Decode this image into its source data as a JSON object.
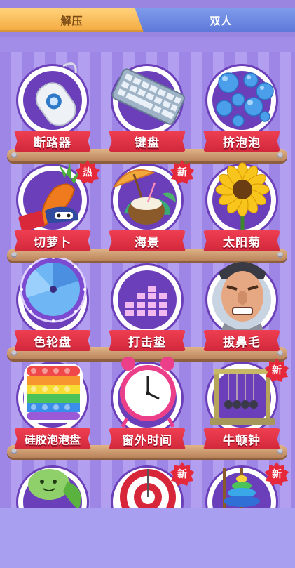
{
  "tabs": {
    "active_label": "解压",
    "inactive_label": "双人"
  },
  "items": [
    {
      "label": "断路器",
      "badge": ""
    },
    {
      "label": "键盘",
      "badge": ""
    },
    {
      "label": "挤泡泡",
      "badge": ""
    },
    {
      "label": "切萝卜",
      "badge": "热"
    },
    {
      "label": "海景",
      "badge": "新"
    },
    {
      "label": "太阳菊",
      "badge": ""
    },
    {
      "label": "色轮盘",
      "badge": ""
    },
    {
      "label": "打击垫",
      "badge": ""
    },
    {
      "label": "拔鼻毛",
      "badge": ""
    },
    {
      "label": "硅胶泡泡盘",
      "badge": ""
    },
    {
      "label": "窗外时间",
      "badge": ""
    },
    {
      "label": "牛顿钟",
      "badge": "新"
    },
    {
      "label": "",
      "badge": ""
    },
    {
      "label": "",
      "badge": "新"
    },
    {
      "label": "",
      "badge": "新"
    }
  ],
  "colors": {
    "board_stripe_a": "#9e86e6",
    "board_stripe_b": "#b39ff0",
    "label_red": "#e33346",
    "active_tab": "#f3a83e",
    "inactive_tab": "#6c86e0"
  },
  "icons": [
    "circuit-breaker-icon",
    "keyboard-icon",
    "bubble-wrap-icon",
    "carrot-icon",
    "beach-coconut-icon",
    "sunflower-icon",
    "color-wheel-icon",
    "drum-pad-icon",
    "nose-hair-face-icon",
    "pop-it-icon",
    "alarm-clock-icon",
    "newtons-cradle-icon",
    "pea-pod-icon",
    "target-icon",
    "ring-stack-icon"
  ]
}
